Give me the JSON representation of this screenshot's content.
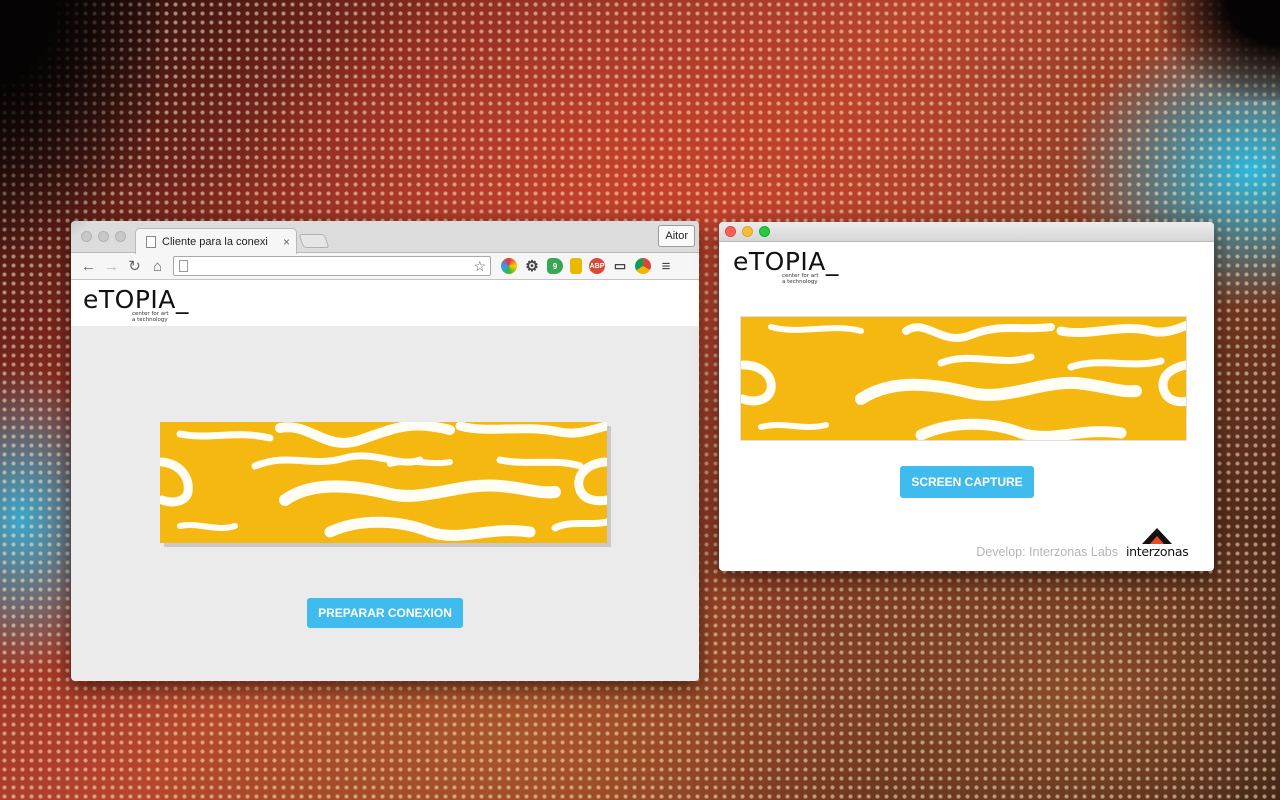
{
  "browser": {
    "tab_title": "Cliente para la conexi",
    "tab_close": "×",
    "profile_name": "Aitor",
    "address_value": "",
    "icons": [
      "back-icon",
      "forward-icon",
      "reload-icon",
      "home-icon",
      "page-icon",
      "star-icon",
      "gear-icon",
      "menu-icon"
    ],
    "ext_labels": {
      "counter": "9",
      "abp": "ABP"
    },
    "page": {
      "logo_text": "eTOPIA_",
      "logo_tagline_1": "center for art",
      "logo_tagline_2": "a technology",
      "button_label": "PREPARAR CONEXION"
    }
  },
  "app": {
    "logo_text": "eTOPIA_",
    "logo_tagline_1": "center for art",
    "logo_tagline_2": "a technology",
    "button_label": "SCREEN CAPTURE",
    "credit_text": "Develop: Interzonas Labs",
    "brand_name": "interzonas"
  },
  "colors": {
    "banner_yellow": "#f4b811",
    "button_blue": "#3fbbed",
    "page_grey": "#ebebeb"
  }
}
